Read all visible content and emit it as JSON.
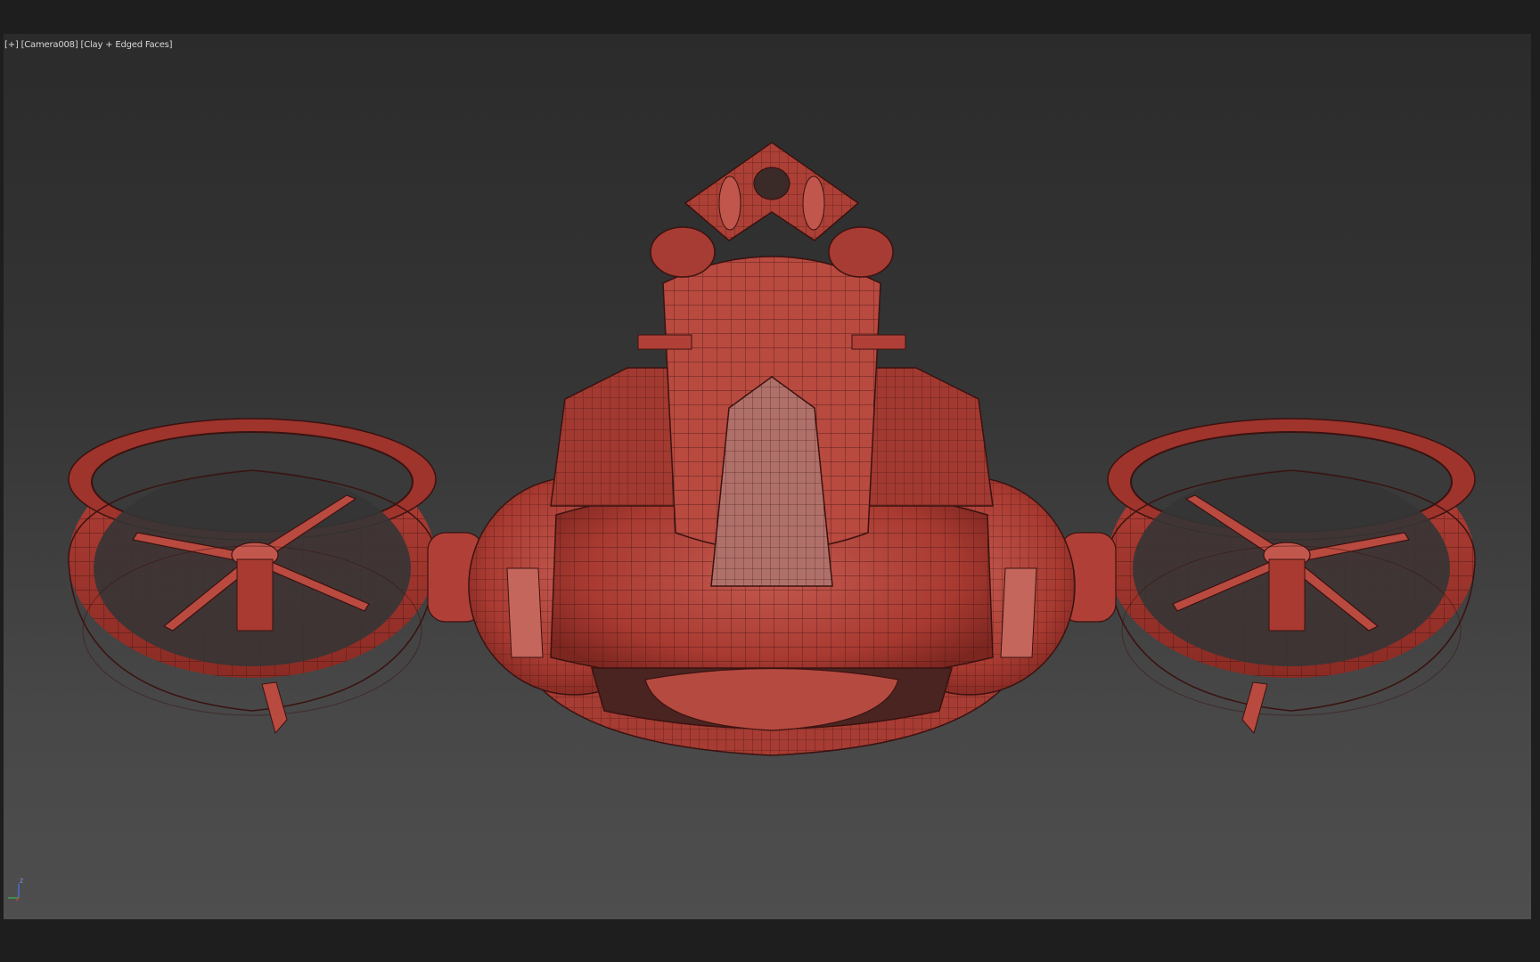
{
  "viewport": {
    "label_plus": "[+]",
    "label_camera": "[Camera008]",
    "label_shading": "[Clay + Edged Faces]",
    "model_color": "#b3443a",
    "wire_color": "#3a1210"
  },
  "gizmo": {
    "z_label": "z",
    "icon": "axis-tripod-icon"
  }
}
